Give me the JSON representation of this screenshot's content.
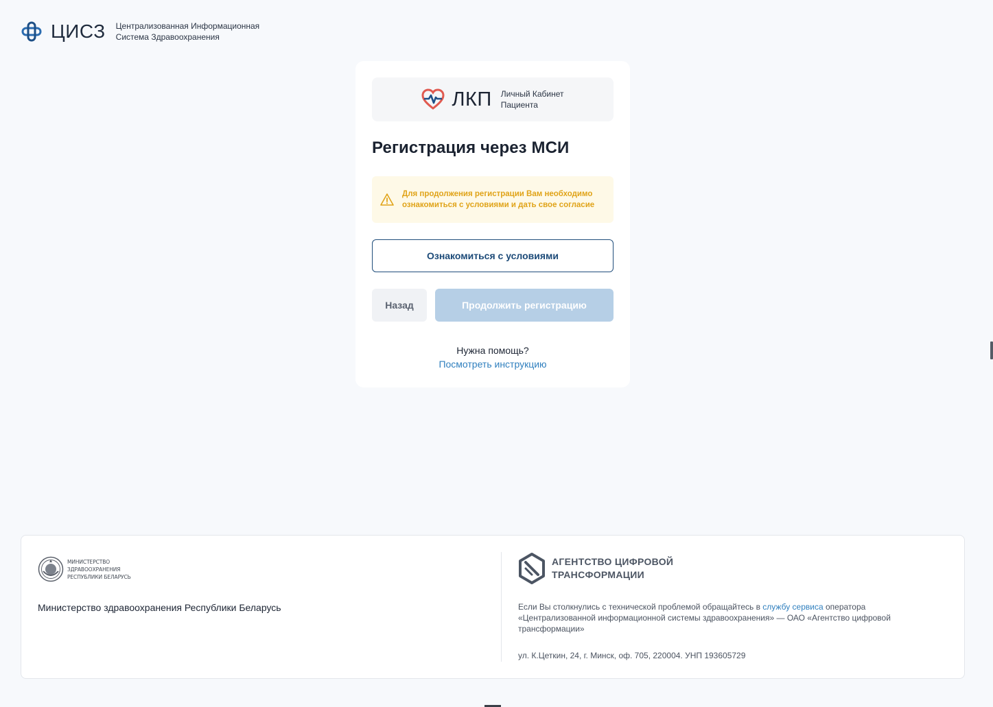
{
  "header": {
    "abbr": "ЦИСЗ",
    "full_line1": "Централизованная Информационная",
    "full_line2": "Система Здравоохранения"
  },
  "card": {
    "brand": {
      "abbr": "ЛКП",
      "full_line1": "Личный Кабинет",
      "full_line2": "Пациента"
    },
    "title": "Регистрация через МСИ",
    "notice": {
      "icon": "warning-triangle-icon",
      "text": "Для продолжения регистрации Вам необходимо ознакомиться с условиями и дать свое согласие"
    },
    "terms_button": "Ознакомиться с условиями",
    "back_button": "Назад",
    "continue_button": "Продолжить регистрацию",
    "help_question": "Нужна помощь?",
    "help_link": "Посмотреть инструкцию"
  },
  "footer": {
    "ministry_logo_lines": [
      "Министерство",
      "здравоохранения",
      "Республики Беларусь"
    ],
    "ministry_name": "Министерство здравоохранения Республики Беларусь",
    "agency_line1": "АГЕНТСТВО ЦИФРОВОЙ",
    "agency_line2": "ТРАНСФОРМАЦИИ",
    "support_before": "Если Вы столкнулись с технической проблемой обращайтесь в ",
    "support_link": "службу сервиса",
    "support_after": " оператора «Централизованной информационной системы здравоохранения» — ОАО «Агентство цифровой трансформации»",
    "address": "ул. К.Цеткин, 24, г. Минск, оф. 705, 220004. УНП 193605729"
  },
  "colors": {
    "background": "#f7f9fc",
    "primary": "#1c4a78",
    "link": "#2f7fbe",
    "warning_text": "#e0a318",
    "warning_bg": "#fef9e7",
    "disabled_button": "#b6cfe6"
  }
}
